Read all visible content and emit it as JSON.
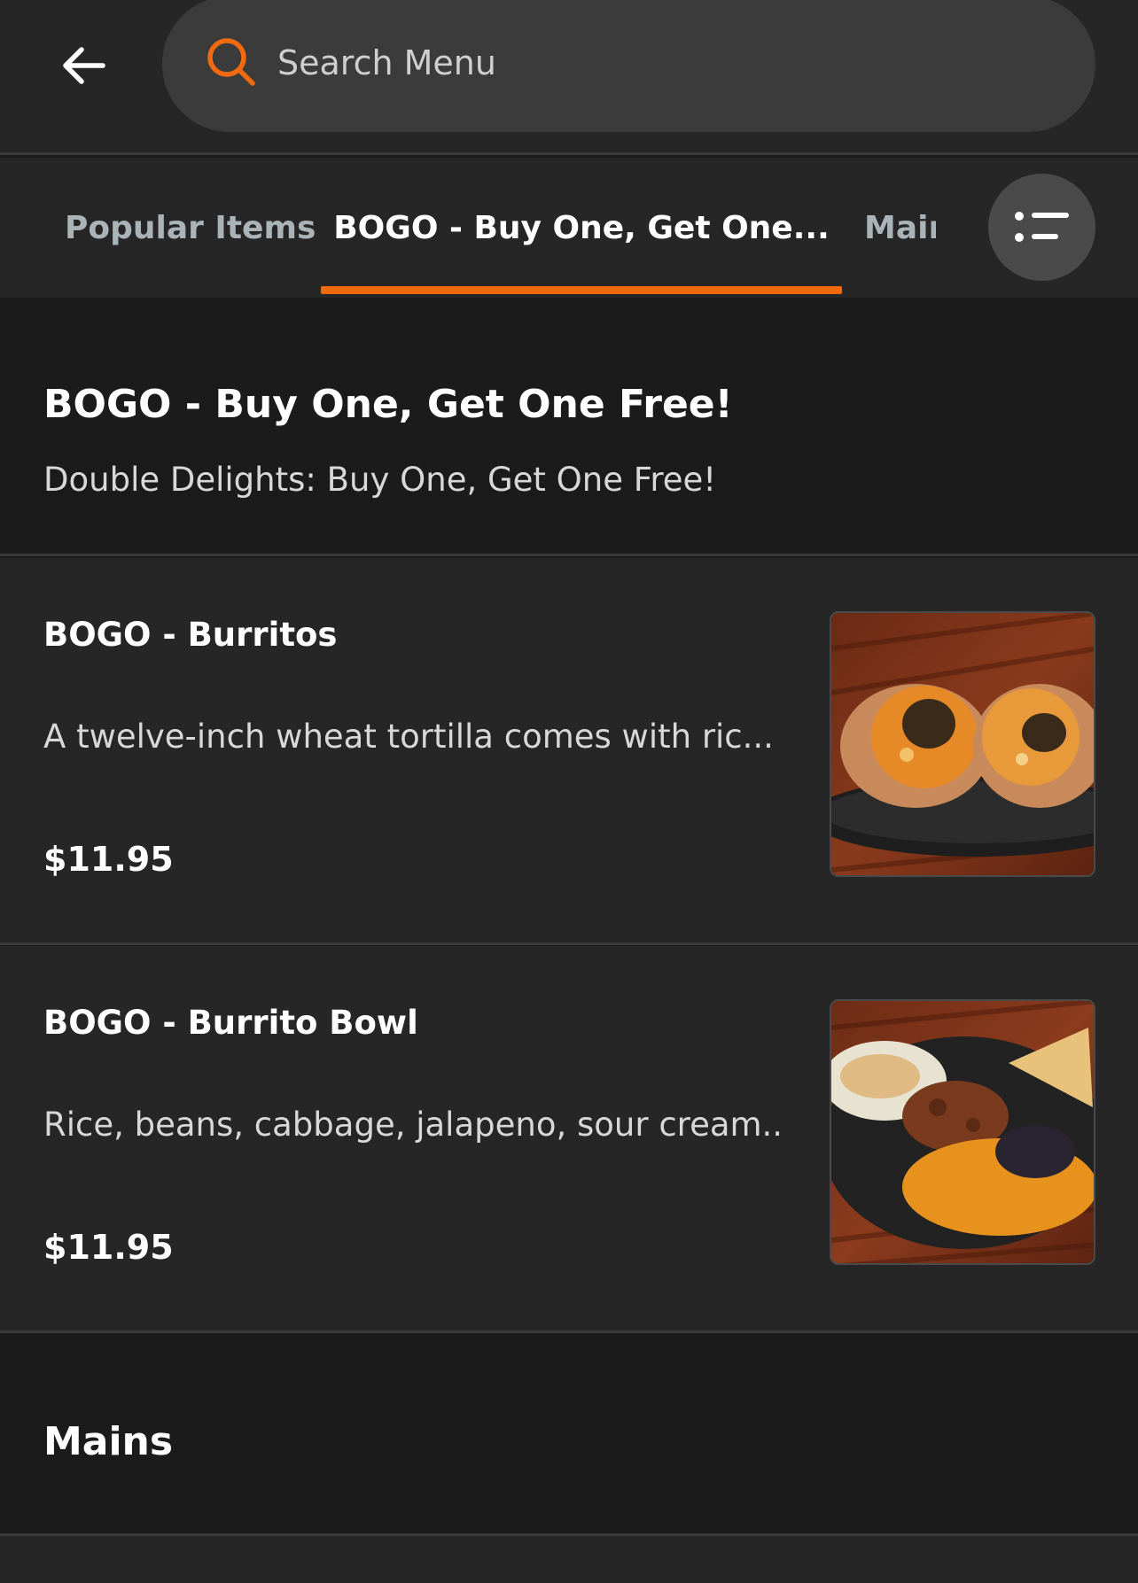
{
  "header": {
    "back_icon": "arrow-left-icon",
    "search_icon": "search-icon",
    "search_placeholder": "Search Menu"
  },
  "tabs": [
    {
      "label": "Popular Items",
      "active": false
    },
    {
      "label": "BOGO - Buy One, Get One...",
      "active": true
    },
    {
      "label": "Mains",
      "active": false
    }
  ],
  "list_toggle_icon": "list-icon",
  "accent_color": "#f26a10",
  "section": {
    "title": "BOGO - Buy One, Get One Free!",
    "description": "Double Delights: Buy One, Get One Free!"
  },
  "items": [
    {
      "name": "BOGO - Burritos",
      "description": "A twelve-inch wheat tortilla comes with ric...",
      "price": "$11.95",
      "image": "burrito-photo"
    },
    {
      "name": "BOGO - Burrito Bowl",
      "description": "Rice, beans, cabbage, jalapeno, sour cream...",
      "price": "$11.95",
      "image": "burrito-bowl-photo"
    }
  ],
  "next_section": {
    "title": "Mains"
  }
}
